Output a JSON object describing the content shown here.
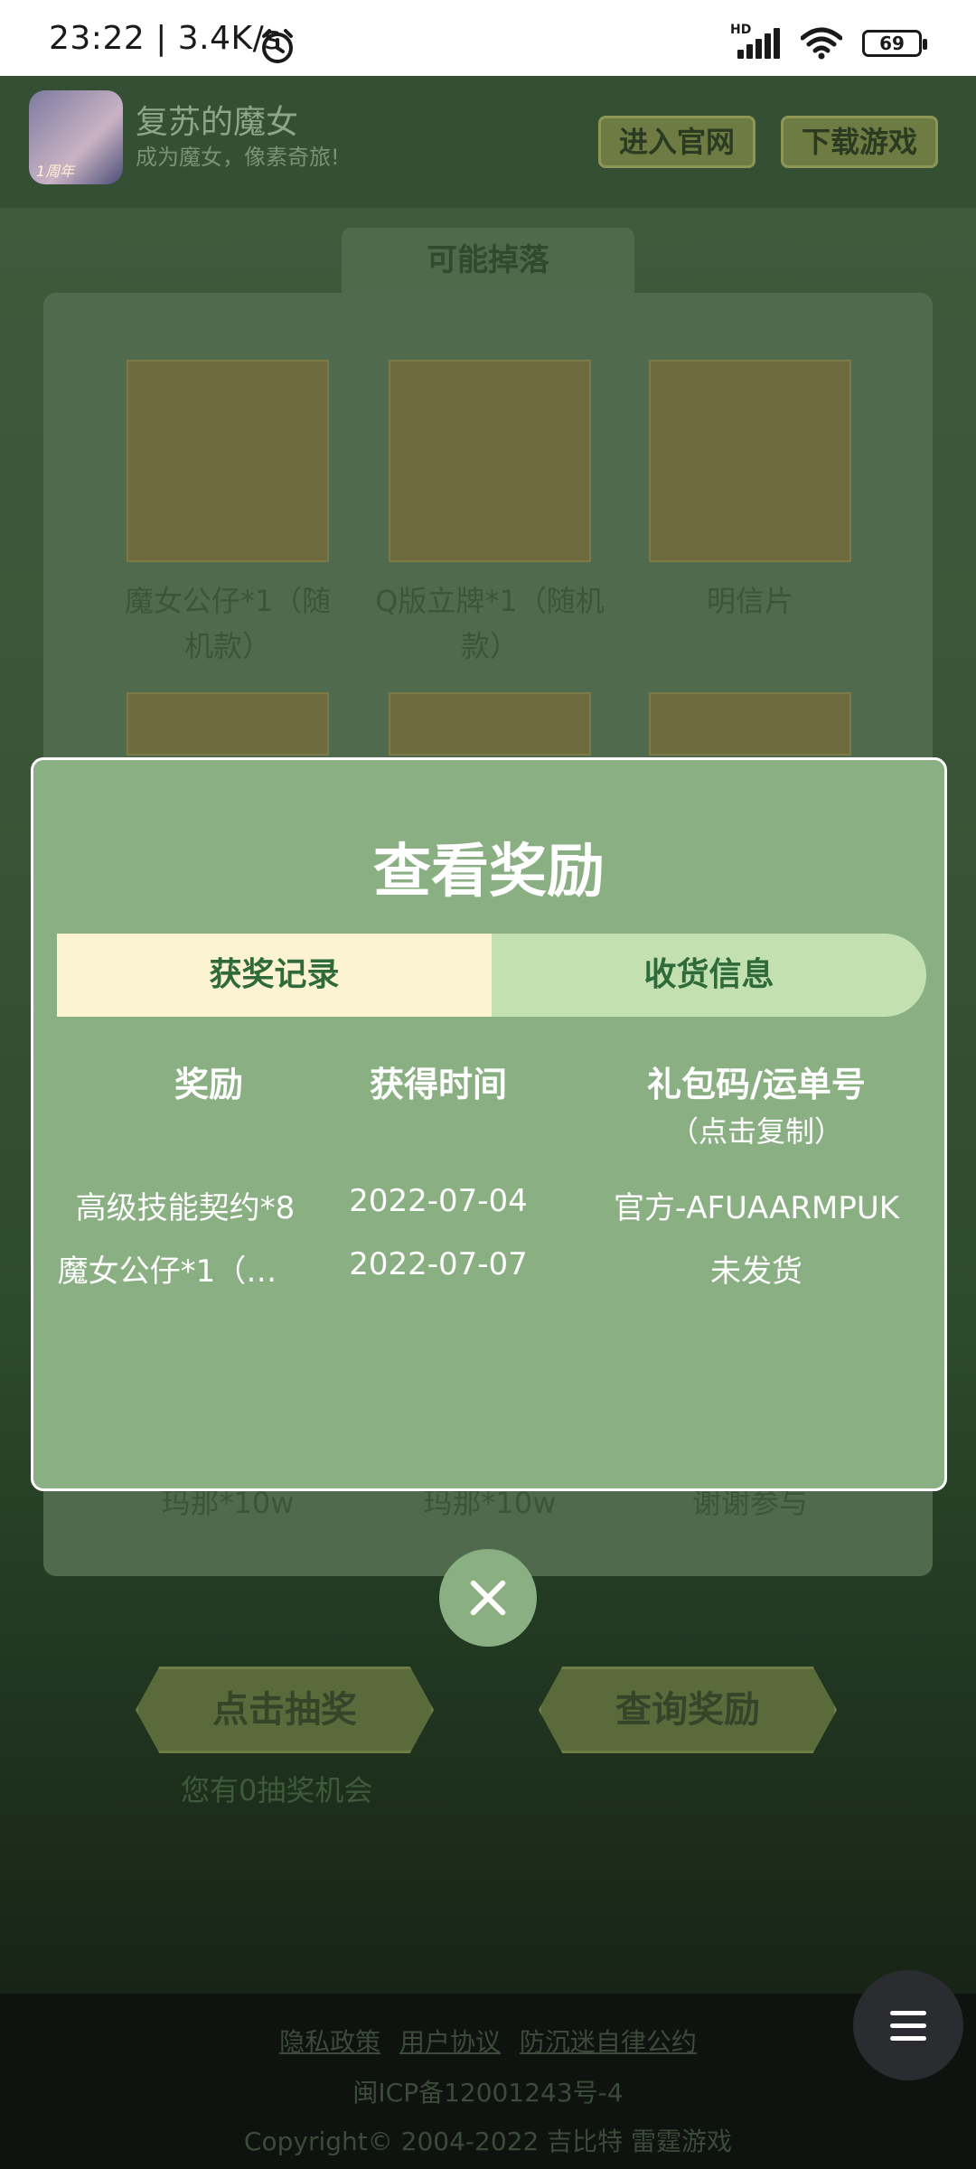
{
  "status_bar": {
    "time": "23:22 | 3.4K/s",
    "hd": "HD",
    "battery": "69",
    "icons": [
      "alarm-icon",
      "signal-icon",
      "wifi-icon",
      "battery-icon"
    ]
  },
  "header": {
    "game_title": "复苏的魔女",
    "game_subtitle": "成为魔女，像素奇旅!",
    "icon_badge": "1周年",
    "official_site_label": "进入官网",
    "download_label": "下载游戏"
  },
  "drops": {
    "title": "可能掉落",
    "items": [
      {
        "label": "魔女公仔*1（随机款）"
      },
      {
        "label": "Q版立牌*1（随机款）"
      },
      {
        "label": "明信片"
      }
    ],
    "bottom_labels": [
      "玛那*10w",
      "玛那*10w",
      "谢谢参与"
    ]
  },
  "actions": {
    "draw_label": "点击抽奖",
    "query_label": "查询奖励",
    "chances_text": "您有0抽奖机会"
  },
  "modal": {
    "title": "查看奖励",
    "tabs": [
      "获奖记录",
      "收货信息"
    ],
    "columns": [
      "奖励",
      "获得时间",
      "礼包码/运单号"
    ],
    "code_hint": "（点击复制）",
    "rows": [
      {
        "reward": "高级技能契约*8",
        "date": "2022-07-04",
        "code": "官方-AFUAARMPUK"
      },
      {
        "reward": "魔女公仔*1（…",
        "date": "2022-07-07",
        "code": "未发货"
      }
    ]
  },
  "footer": {
    "links": [
      "隐私政策",
      "用户协议",
      "防沉迷自律公约"
    ],
    "icp": "闽ICP备12001243号-4",
    "copyright": "Copyright© 2004-2022  吉比特  雷霆游戏"
  }
}
